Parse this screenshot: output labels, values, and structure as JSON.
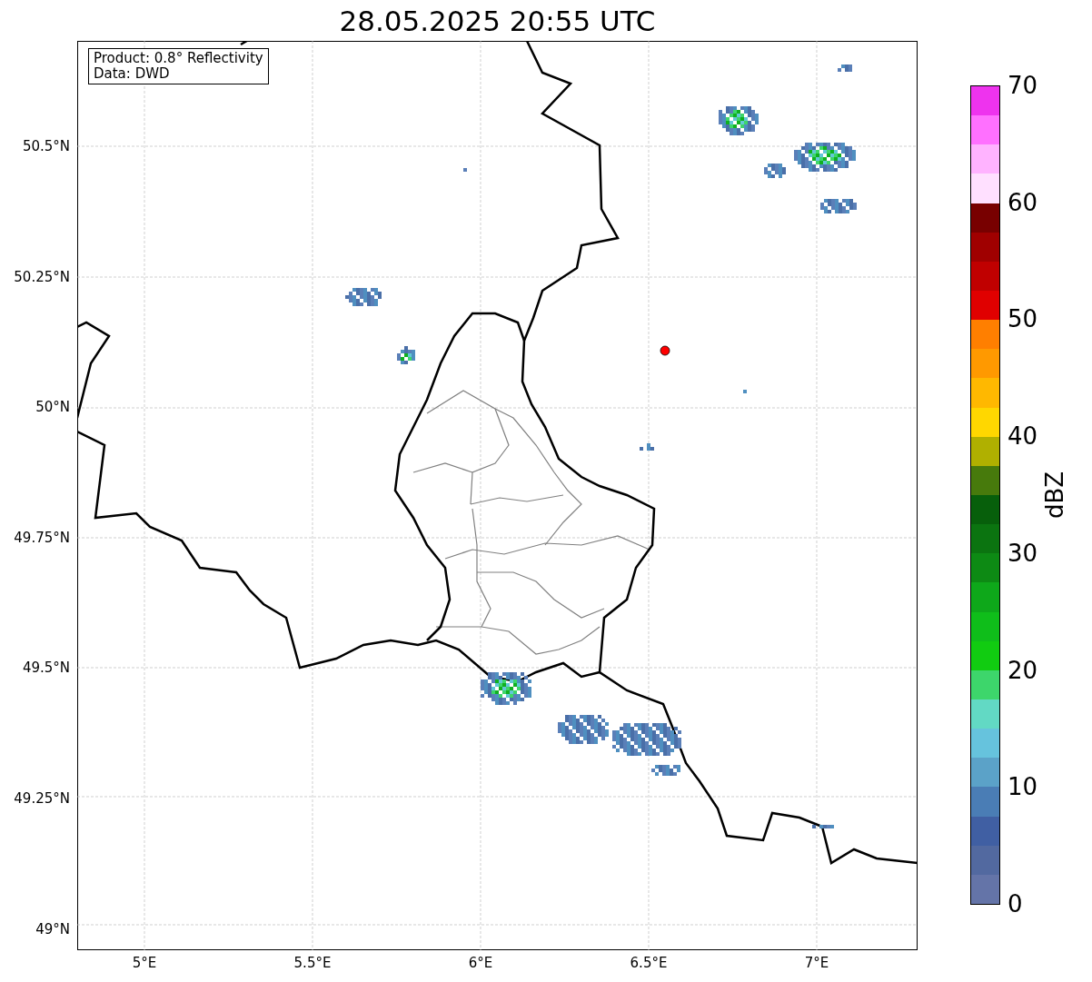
{
  "title": "28.05.2025 20:55 UTC",
  "legend_box": {
    "lines": [
      "Product: 0.8° Reflectivity",
      "Data: DWD"
    ]
  },
  "y_ticks": [
    "50.5°N",
    "50.25°N",
    "50°N",
    "49.75°N",
    "49.5°N",
    "49.25°N",
    "49°N"
  ],
  "x_ticks": [
    "5°E",
    "5.5°E",
    "6°E",
    "6.5°E",
    "7°E"
  ],
  "colorbar": {
    "label": "dBZ",
    "ticks": [
      "70",
      "60",
      "50",
      "40",
      "30",
      "20",
      "10",
      "0"
    ],
    "segments": [
      {
        "color": "#ee33ee"
      },
      {
        "color": "#ff70ff"
      },
      {
        "color": "#ffb3ff"
      },
      {
        "color": "#ffe0ff"
      },
      {
        "color": "#780000"
      },
      {
        "color": "#a00000"
      },
      {
        "color": "#c00000"
      },
      {
        "color": "#e00000"
      },
      {
        "color": "#ff7f00"
      },
      {
        "color": "#ff9900"
      },
      {
        "color": "#ffb800"
      },
      {
        "color": "#ffd700"
      },
      {
        "color": "#b0b000"
      },
      {
        "color": "#477a0c"
      },
      {
        "color": "#075f0b"
      },
      {
        "color": "#0b7410"
      },
      {
        "color": "#0d8a14"
      },
      {
        "color": "#0ea81a"
      },
      {
        "color": "#0fbe1a"
      },
      {
        "color": "#11cc11"
      },
      {
        "color": "#3dd66b"
      },
      {
        "color": "#62d9c4"
      },
      {
        "color": "#66c3dd"
      },
      {
        "color": "#5ba2c8"
      },
      {
        "color": "#4a7db5"
      },
      {
        "color": "#405fa3"
      },
      {
        "color": "#5269a0"
      },
      {
        "color": "#6474a8"
      }
    ]
  }
}
